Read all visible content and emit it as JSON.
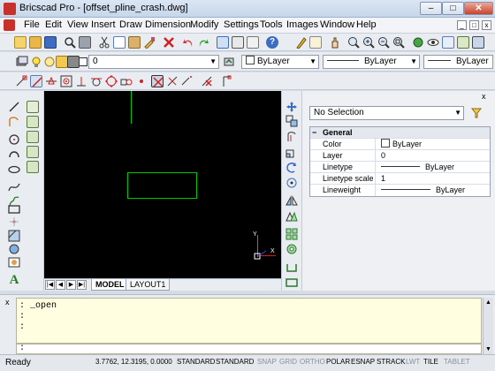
{
  "window": {
    "title": "Bricscad Pro - [offset_pline_crash.dwg]",
    "min": "–",
    "max": "□",
    "close": "✕"
  },
  "menubar": {
    "items": [
      "File",
      "Edit",
      "View",
      "Insert",
      "Draw",
      "Dimension",
      "Modify",
      "Settings",
      "Tools",
      "Images",
      "Window",
      "Help"
    ],
    "mdi": [
      "_",
      "□",
      "x"
    ]
  },
  "layer_toolbar": {
    "layer_value": "0",
    "color_value": "ByLayer",
    "linetype_value": "ByLayer",
    "lineweight_value": "ByLayer"
  },
  "properties": {
    "selection": "No Selection",
    "section_title": "General",
    "section_toggle": "−",
    "rows": [
      {
        "name": "Color",
        "value": "ByLayer",
        "kind": "color"
      },
      {
        "name": "Layer",
        "value": "0",
        "kind": "text"
      },
      {
        "name": "Linetype",
        "value": "ByLayer",
        "kind": "line"
      },
      {
        "name": "Linetype scale",
        "value": "1",
        "kind": "text"
      },
      {
        "name": "Lineweight",
        "value": "ByLayer",
        "kind": "line"
      }
    ],
    "close": "x"
  },
  "drawing_tabs": {
    "tabs": [
      "MODEL",
      "LAYOUT1"
    ],
    "active": "MODEL",
    "nav": [
      "|◀",
      "◀",
      "▶",
      "▶|"
    ]
  },
  "ucs": {
    "y_label": "Y",
    "x_label": "X"
  },
  "command": {
    "history": [
      ": _open",
      ":",
      ":"
    ],
    "prompt": ":",
    "close": "x"
  },
  "status": {
    "ready": "Ready",
    "coords": "3.7762, 12.3195, 0.0000",
    "buttons": [
      {
        "label": "STANDARD",
        "on": true
      },
      {
        "label": "STANDARD",
        "on": true
      },
      {
        "label": "SNAP",
        "on": false
      },
      {
        "label": "GRID",
        "on": false
      },
      {
        "label": "ORTHO",
        "on": false
      },
      {
        "label": "POLAR",
        "on": true
      },
      {
        "label": "ESNAP",
        "on": true
      },
      {
        "label": "STRACK",
        "on": true
      },
      {
        "label": "LWT",
        "on": false
      },
      {
        "label": "TILE",
        "on": true
      },
      {
        "label": "TABLET",
        "on": false
      }
    ]
  },
  "colors": {
    "canvas": "#000000",
    "geometry": "#00c800",
    "command_bg": "#fffee1",
    "accent_red": "#c8302b"
  }
}
